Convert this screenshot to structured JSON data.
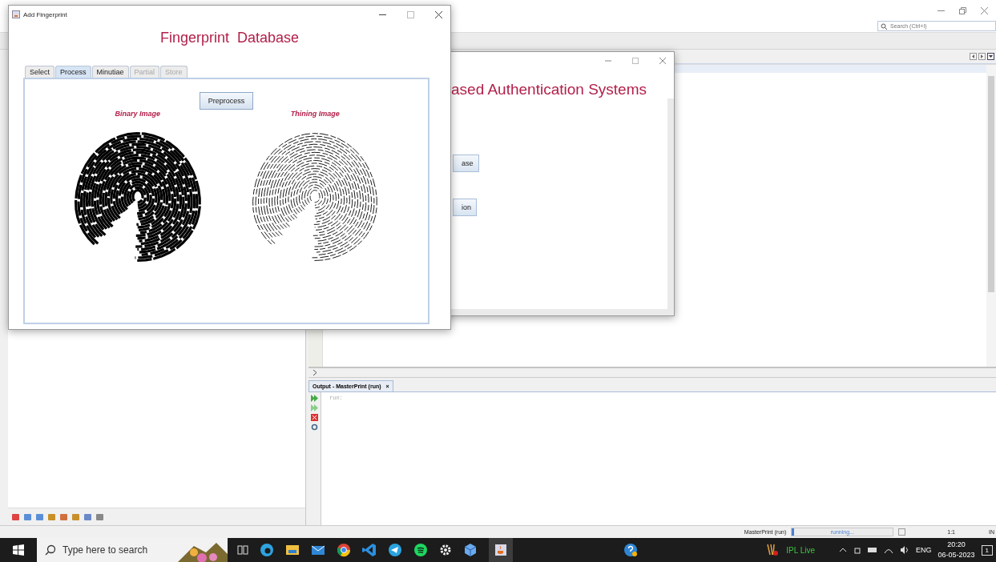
{
  "ide": {
    "search": {
      "placeholder": "Search (Ctrl+I)"
    },
    "output": {
      "tab": {
        "label": "Output - MasterPrint (run)",
        "close": "×",
        "selected": true
      },
      "lines": [
        "run:"
      ]
    },
    "status_bar": {
      "task": "MasterPrint (run)",
      "progress": "running...",
      "level": 0.02,
      "position": "1:1",
      "mode": "IN"
    }
  },
  "back_window": {
    "heading": "ased Authentication Systems",
    "buttons": [
      "ase",
      "ion"
    ]
  },
  "front_window": {
    "title": "Add Fingerprint",
    "heading": "Fingerprint  Database",
    "tabs": [
      {
        "label": "Select",
        "selected": false,
        "disabled": false
      },
      {
        "label": "Process",
        "selected": true,
        "disabled": false
      },
      {
        "label": "Minutiae",
        "selected": false,
        "disabled": false
      },
      {
        "label": "Partial",
        "selected": false,
        "disabled": true
      },
      {
        "label": "Store",
        "selected": false,
        "disabled": true
      }
    ],
    "button": "Preprocess",
    "images": [
      {
        "caption": "Binary Image",
        "kind": "binary"
      },
      {
        "caption": "Thining Image",
        "kind": "thinned"
      }
    ]
  },
  "taskbar": {
    "search": {
      "placeholder": "Type here to search"
    },
    "widget": "IPL Live",
    "language": "ENG",
    "time": "20:20",
    "date": "06-05-2023",
    "notifications": "1"
  }
}
